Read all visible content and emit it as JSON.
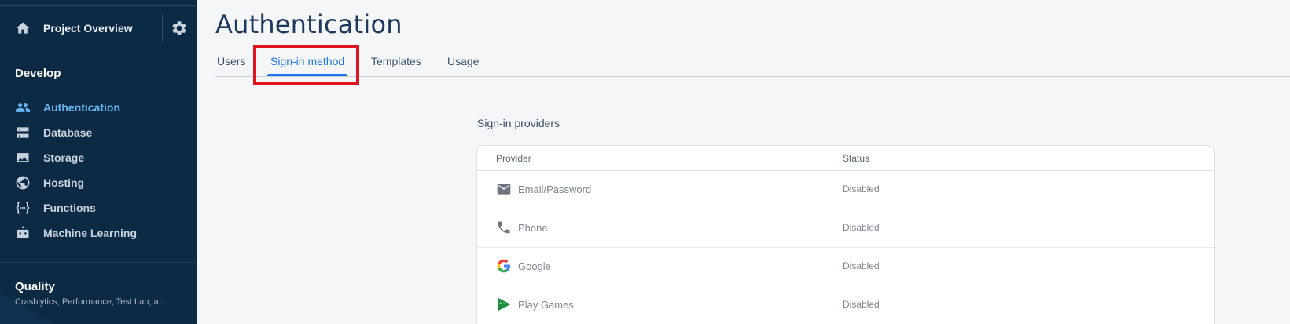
{
  "sidebar": {
    "project_label": "Project Overview",
    "develop_title": "Develop",
    "items": [
      {
        "label": "Authentication",
        "icon": "people-icon",
        "active": true
      },
      {
        "label": "Database",
        "icon": "database-icon",
        "active": false
      },
      {
        "label": "Storage",
        "icon": "image-icon",
        "active": false
      },
      {
        "label": "Hosting",
        "icon": "globe-icon",
        "active": false
      },
      {
        "label": "Functions",
        "icon": "functions-icon",
        "active": false
      },
      {
        "label": "Machine Learning",
        "icon": "robot-icon",
        "active": false
      }
    ],
    "quality_title": "Quality",
    "quality_subtitle": "Crashlytics, Performance, Test Lab, a..."
  },
  "main": {
    "title": "Authentication",
    "tabs": [
      {
        "label": "Users"
      },
      {
        "label": "Sign-in method",
        "active": true
      },
      {
        "label": "Templates"
      },
      {
        "label": "Usage"
      }
    ],
    "providers_title": "Sign-in providers",
    "columns": {
      "provider": "Provider",
      "status": "Status"
    },
    "providers": [
      {
        "name": "Email/Password",
        "status": "Disabled",
        "icon": "email-icon"
      },
      {
        "name": "Phone",
        "status": "Disabled",
        "icon": "phone-icon"
      },
      {
        "name": "Google",
        "status": "Disabled",
        "icon": "google-icon"
      },
      {
        "name": "Play Games",
        "status": "Disabled",
        "icon": "play-games-icon"
      }
    ]
  },
  "colors": {
    "sidebar_bg": "#0d2a45",
    "accent": "#1a73e8",
    "active_nav": "#66b5f2",
    "highlight_box": "#e0141e"
  }
}
